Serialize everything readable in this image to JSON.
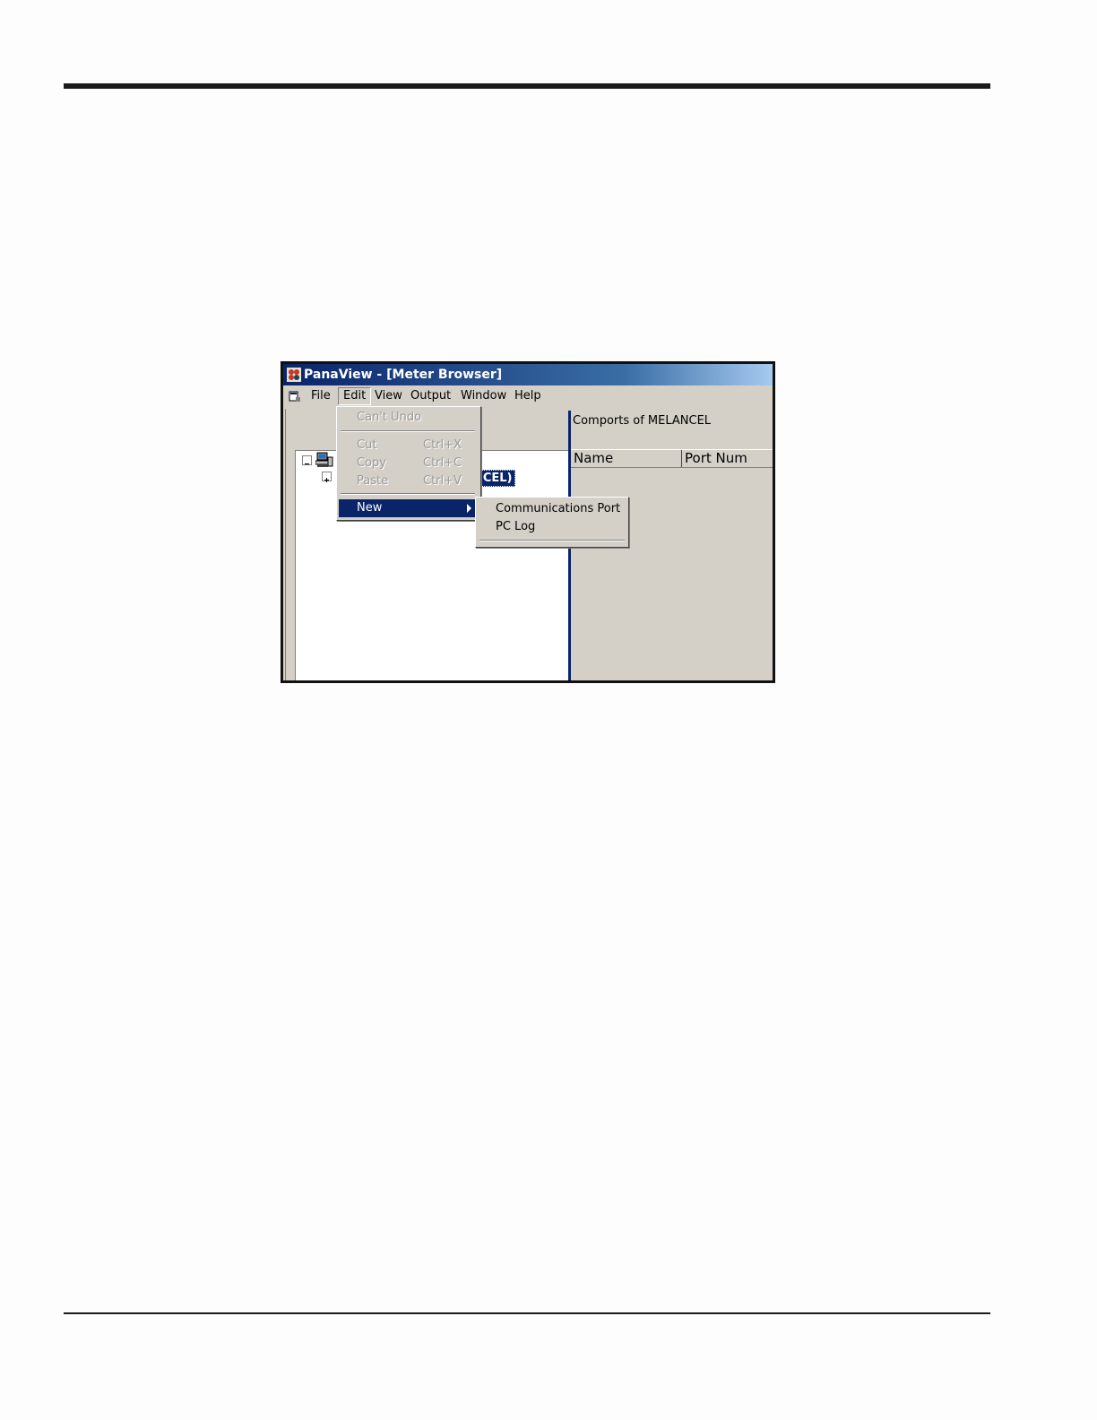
{
  "window": {
    "title": "PanaView - [Meter Browser]"
  },
  "menubar": {
    "items": [
      "File",
      "Edit",
      "View",
      "Output",
      "Window",
      "Help"
    ]
  },
  "edit_menu": {
    "undo": "Can't Undo",
    "cut": {
      "label": "Cut",
      "shortcut": "Ctrl+X"
    },
    "copy": {
      "label": "Copy",
      "shortcut": "Ctrl+C"
    },
    "paste": {
      "label": "Paste",
      "shortcut": "Ctrl+V"
    },
    "new": "New"
  },
  "new_submenu": {
    "items": [
      "Communications Port",
      "PC Log"
    ]
  },
  "tree": {
    "selected_label": "ICEL)"
  },
  "right_pane": {
    "title": "Comports of MELANCEL",
    "columns": [
      "Name",
      "Port Num"
    ]
  },
  "colors": {
    "titlebar": "#0a246a",
    "highlight": "#0a246a",
    "face": "#d4d0c8"
  }
}
